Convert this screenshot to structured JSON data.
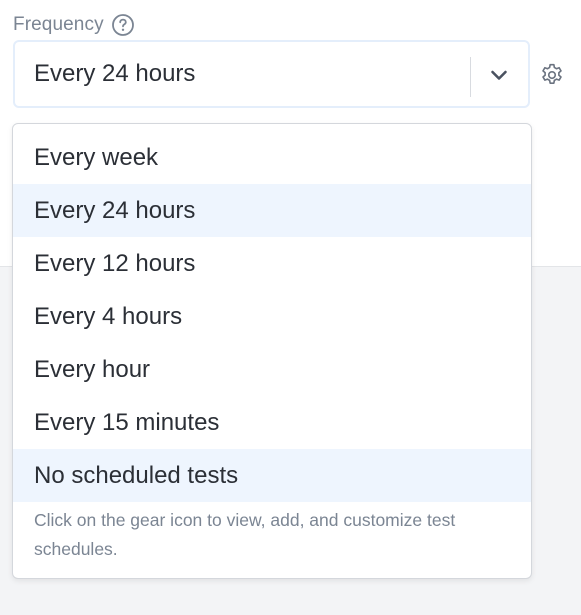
{
  "frequency": {
    "label": "Frequency",
    "help_icon": "question-circle-icon",
    "selected_value": "Every 24 hours",
    "dropdown_icon": "chevron-down-icon",
    "settings_icon": "gear-icon"
  },
  "menu": {
    "options": [
      {
        "label": "Every week",
        "highlighted": false
      },
      {
        "label": "Every 24 hours",
        "highlighted": true
      },
      {
        "label": "Every 12 hours",
        "highlighted": false
      },
      {
        "label": "Every 4 hours",
        "highlighted": false
      },
      {
        "label": "Every hour",
        "highlighted": false
      },
      {
        "label": "Every 15 minutes",
        "highlighted": false
      },
      {
        "label": "No scheduled tests",
        "highlighted": true
      }
    ],
    "hint": "Click on the gear icon to view, add, and customize test schedules."
  },
  "colors": {
    "label_gray": "#7b8593",
    "text_dark": "#2b2f36",
    "highlight_blue": "#eef5fe",
    "focus_border": "#e4eefb",
    "backdrop_gray": "#f3f4f6"
  }
}
